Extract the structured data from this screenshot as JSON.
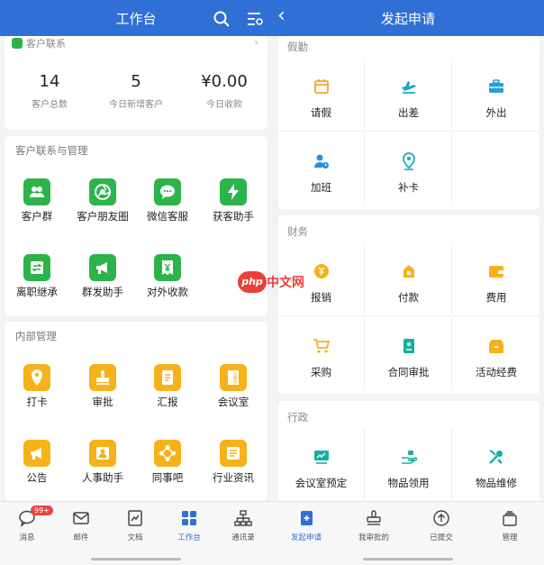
{
  "left": {
    "header": {
      "title": "工作台"
    },
    "customer_card": {
      "heading": "客户联系",
      "stats": [
        {
          "value": "14",
          "label": "客户总数"
        },
        {
          "value": "5",
          "label": "今日新增客户"
        },
        {
          "value": "¥0.00",
          "label": "今日收款"
        }
      ]
    },
    "manage": {
      "title": "客户联系与管理",
      "items": [
        "客户群",
        "客户朋友圈",
        "微信客服",
        "获客助手",
        "离职继承",
        "群发助手",
        "对外收款"
      ]
    },
    "internal": {
      "title": "内部管理",
      "items": [
        "打卡",
        "审批",
        "汇报",
        "会议室",
        "公告",
        "人事助手",
        "同事吧",
        "行业资讯"
      ]
    },
    "tabs": [
      {
        "label": "消息",
        "badge": "99+"
      },
      {
        "label": "邮件"
      },
      {
        "label": "文档"
      },
      {
        "label": "工作台"
      },
      {
        "label": "通讯录"
      }
    ],
    "active_tab": "工作台"
  },
  "right": {
    "header": {
      "title": "发起申请",
      "back": "‹"
    },
    "sections": [
      {
        "title": "假勤",
        "items": [
          "请假",
          "出差",
          "外出",
          "加班",
          "补卡"
        ]
      },
      {
        "title": "财务",
        "items": [
          "报销",
          "付款",
          "费用",
          "采购",
          "合同审批",
          "活动经费"
        ]
      },
      {
        "title": "行政",
        "items": [
          "会议室预定",
          "物品领用",
          "物品维修"
        ]
      }
    ],
    "tabs": [
      {
        "label": "发起申请"
      },
      {
        "label": "我审批的"
      },
      {
        "label": "已提交"
      },
      {
        "label": "管理"
      }
    ],
    "active_tab": "发起申请"
  },
  "watermark": {
    "badge": "php",
    "text": "中文网"
  },
  "colors": {
    "brand": "#2f6fd6",
    "green": "#2cb44b",
    "yellow": "#f5b21a",
    "badge": "#f04141"
  }
}
